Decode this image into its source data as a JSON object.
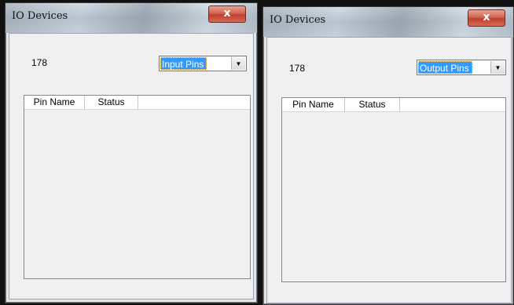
{
  "windows": [
    {
      "title": "IO Devices",
      "close_glyph": "x",
      "number": "178",
      "combo_value": "Input Pins",
      "columns": [
        "Pin Name",
        "Status"
      ]
    },
    {
      "title": "IO Devices",
      "close_glyph": "x",
      "number": "178",
      "combo_value": "Output Pins",
      "columns": [
        "Pin Name",
        "Status"
      ]
    }
  ],
  "icons": {
    "close": "close-icon",
    "dropdown": "chevron-down-icon"
  }
}
